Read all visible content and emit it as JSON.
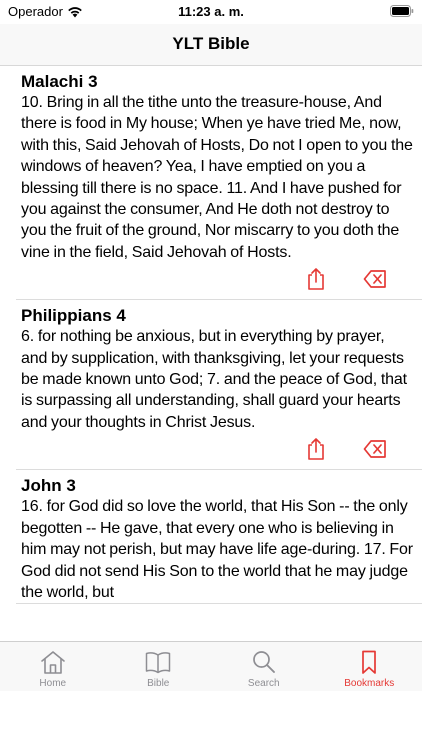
{
  "status_bar": {
    "carrier": "Operador",
    "time": "11:23 a. m."
  },
  "nav": {
    "title": "YLT Bible"
  },
  "bookmarks": [
    {
      "reference": "Malachi 3",
      "text": "10. Bring in all the tithe unto the treasure-house, And there is food in My house; When ye have tried Me, now, with this, Said Jehovah of Hosts, Do not I open to you the windows of heaven? Yea, I have emptied on you a blessing till there is no space. 11. And I have pushed for you against the consumer, And He doth not destroy to you the fruit of the ground, Nor miscarry to you doth the vine in the field, Said Jehovah of Hosts."
    },
    {
      "reference": "Philippians 4",
      "text": "6. for nothing be anxious, but in everything by prayer, and by supplication, with thanksgiving, let your requests be made known unto God; 7. and the peace of God, that is surpassing all understanding, shall guard your hearts and your thoughts in Christ Jesus."
    },
    {
      "reference": "John 3",
      "text": "16. for God did so love the world, that His Son -- the only begotten -- He gave, that every one who is believing in him may not perish, but may have life age-during. 17. For God did not send His Son to the world that he may judge the world, but"
    }
  ],
  "tabs": [
    {
      "label": "Home",
      "icon": "house-icon"
    },
    {
      "label": "Bible",
      "icon": "book-icon"
    },
    {
      "label": "Search",
      "icon": "magnifier-icon"
    },
    {
      "label": "Bookmarks",
      "icon": "bookmark-icon"
    }
  ],
  "colors": {
    "accent": "#e53935",
    "inactive": "#8e8e93"
  }
}
